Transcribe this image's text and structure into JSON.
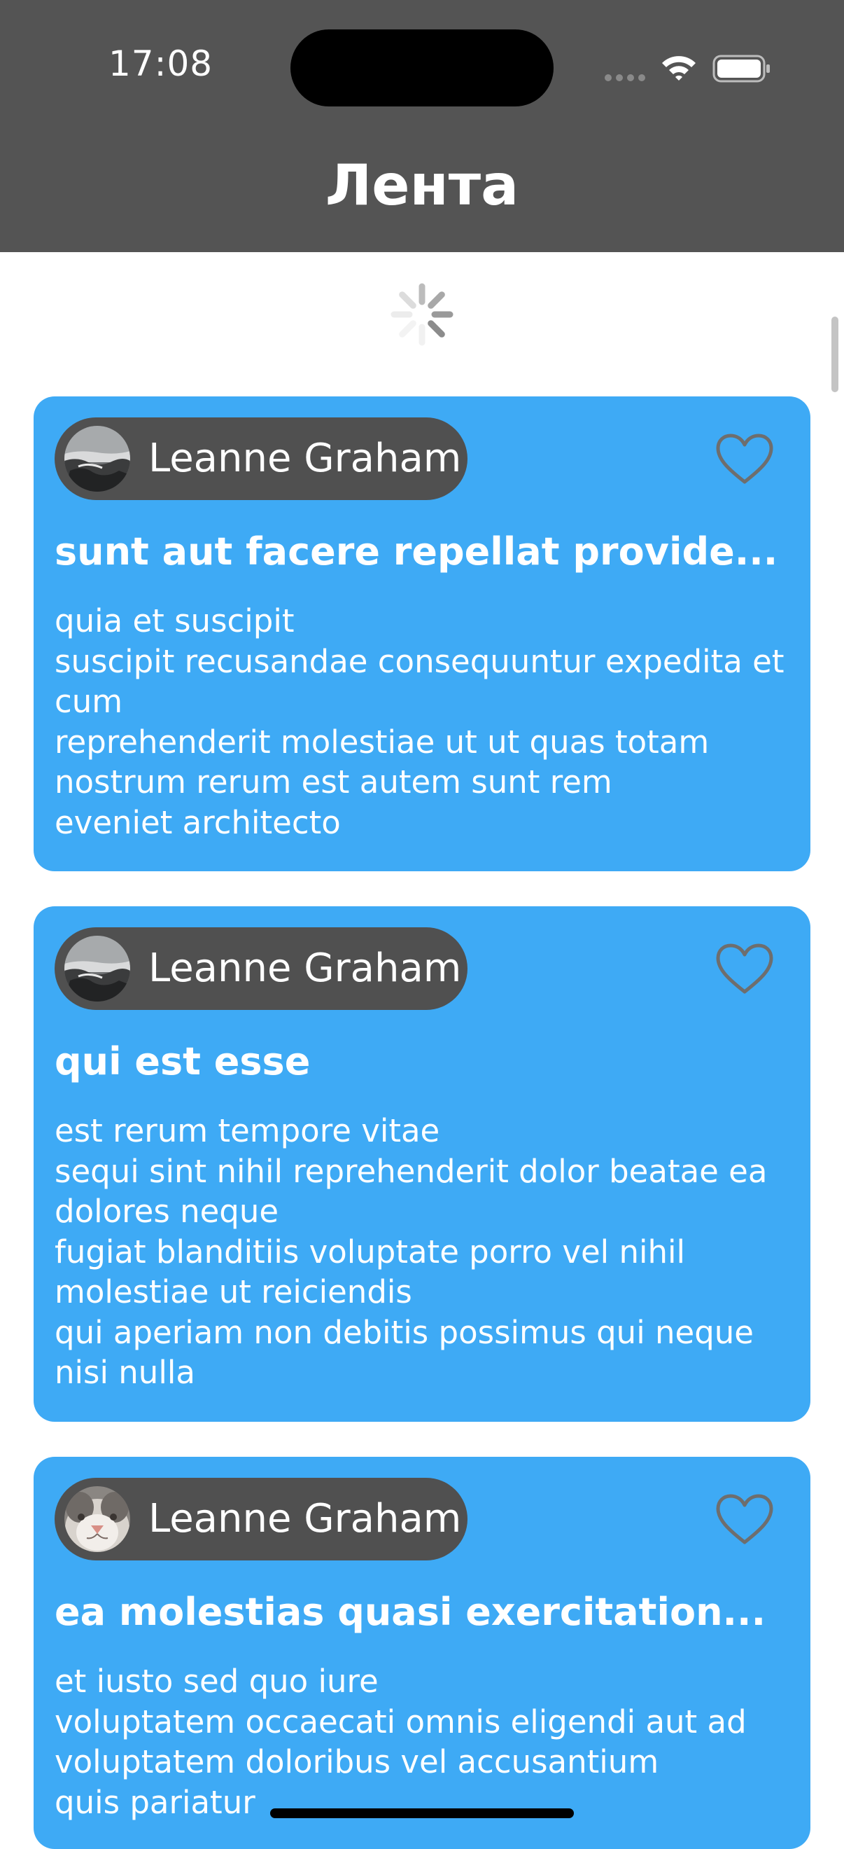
{
  "status_bar": {
    "time": "17:08"
  },
  "nav": {
    "title": "Лента"
  },
  "posts": [
    {
      "author": "Leanne Graham",
      "avatar": "rocky-shore-photo",
      "title": "sunt aut facere repellat provide...",
      "body": "quia et suscipit\nsuscipit recusandae consequuntur expedita et cum\nreprehenderit molestiae ut ut quas totam\nnostrum rerum est autem sunt rem\neveniet architecto",
      "liked": false
    },
    {
      "author": "Leanne Graham",
      "avatar": "rocky-shore-photo",
      "title": "qui est esse",
      "body": "est rerum tempore vitae\nsequi sint nihil reprehenderit dolor beatae ea dolores neque\nfugiat blanditiis voluptate porro vel nihil molestiae ut reiciendis\nqui aperiam non debitis possimus qui neque nisi nulla",
      "liked": false
    },
    {
      "author": "Leanne Graham",
      "avatar": "cat-face-photo",
      "title": "ea molestias quasi exercitation...",
      "body": "et iusto sed quo iure\nvoluptatem occaecati omnis eligendi aut ad\nvoluptatem doloribus vel accusantium\nquis pariatur",
      "liked": false
    }
  ],
  "colors": {
    "header_bg": "#545454",
    "card_bg": "#3eaaf5",
    "author_pill_bg": "#505050",
    "heart_outline": "#6e6e6e"
  }
}
